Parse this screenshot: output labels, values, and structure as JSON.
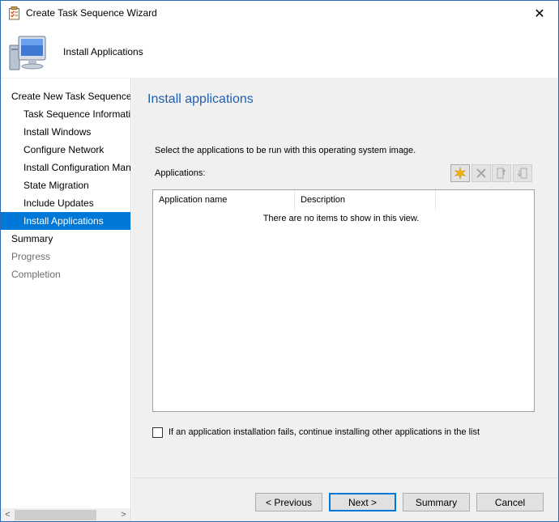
{
  "window": {
    "title": "Create Task Sequence Wizard",
    "close_glyph": "✕"
  },
  "header": {
    "title": "Install Applications"
  },
  "nav": {
    "items": [
      {
        "label": "Create New Task Sequence",
        "level": 0,
        "state": "normal"
      },
      {
        "label": "Task Sequence Information",
        "level": 1,
        "state": "normal"
      },
      {
        "label": "Install Windows",
        "level": 1,
        "state": "normal"
      },
      {
        "label": "Configure Network",
        "level": 1,
        "state": "normal"
      },
      {
        "label": "Install Configuration Manager",
        "level": 1,
        "state": "normal"
      },
      {
        "label": "State Migration",
        "level": 1,
        "state": "normal"
      },
      {
        "label": "Include Updates",
        "level": 1,
        "state": "normal"
      },
      {
        "label": "Install Applications",
        "level": 1,
        "state": "selected"
      },
      {
        "label": "Summary",
        "level": 0,
        "state": "normal"
      },
      {
        "label": "Progress",
        "level": 0,
        "state": "disabled"
      },
      {
        "label": "Completion",
        "level": 0,
        "state": "disabled"
      }
    ]
  },
  "scrollbar": {
    "left_glyph": "<",
    "right_glyph": ">"
  },
  "main": {
    "page_title": "Install applications",
    "instructions": "Select the applications to be run with this operating system image.",
    "applications_label": "Applications:",
    "toolbar": {
      "icons": [
        "new-icon",
        "delete-icon",
        "move-up-icon",
        "move-down-icon"
      ]
    },
    "list": {
      "columns": [
        "Application name",
        "Description"
      ],
      "empty_message": "There are no items to show in this view."
    },
    "checkbox": {
      "label": "If an application installation fails, continue installing other applications in the list",
      "checked": false
    }
  },
  "footer": {
    "previous_label": "< Previous",
    "next_label": "Next >",
    "summary_label": "Summary",
    "cancel_label": "Cancel"
  },
  "colors": {
    "selection": "#0078d7",
    "title_blue": "#1f5fb2",
    "panel": "#f0f0f0",
    "border": "#2b6cb7"
  }
}
